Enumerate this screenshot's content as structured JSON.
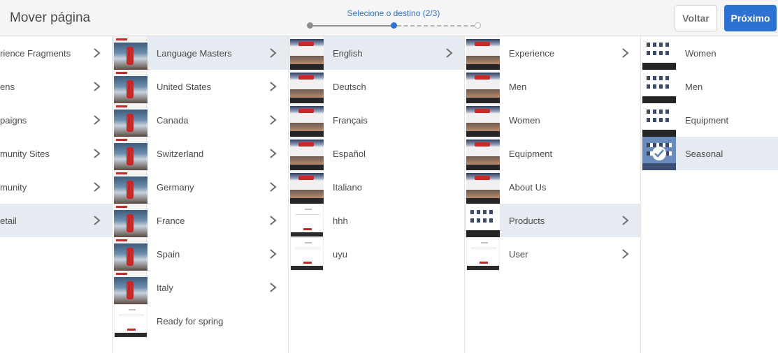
{
  "header": {
    "title": "Mover página",
    "step_label": "Selecione o destino (2/3)",
    "back_label": "Voltar",
    "next_label": "Próximo",
    "accent_color": "#2d72d2"
  },
  "columns": {
    "col0": [
      "rience Fragments",
      "ens",
      "paigns",
      "munity Sites",
      "munity",
      "etail"
    ],
    "col1": [
      "Language Masters",
      "United States",
      "Canada",
      "Switzerland",
      "Germany",
      "France",
      "Spain",
      "Italy",
      "Ready for spring"
    ],
    "col2": [
      "English",
      "Deutsch",
      "Français",
      "Español",
      "Italiano",
      "hhh",
      "uyu"
    ],
    "col3": [
      "Experience",
      "Men",
      "Women",
      "Equipment",
      "About Us",
      "Products",
      "User"
    ],
    "col4": [
      "Women",
      "Men",
      "Equipment",
      "Seasonal"
    ]
  }
}
